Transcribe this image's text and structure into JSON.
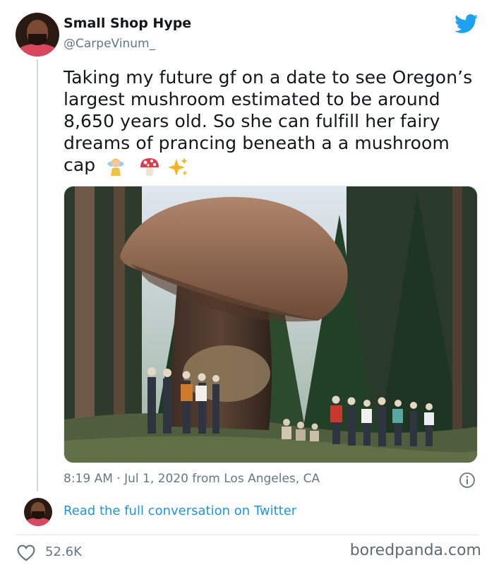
{
  "user": {
    "display_name": "Small Shop Hype",
    "handle": "@CarpeVinum_",
    "avatar": "user-avatar"
  },
  "tweet": {
    "text": "Taking my future gf on a date to see Oregon’s largest mushroom estimated to be around 8,650 years old. So she can fulfill her fairy dreams of prancing beneath a a mushroom cap",
    "emojis": [
      "fairy-emoji",
      "mushroom-emoji",
      "sparkles-emoji"
    ],
    "image": "giant-mushroom-photo",
    "timestamp": "8:19 AM · Jul 1, 2020 from Los Angeles, CA"
  },
  "footer": {
    "read_link": "Read the full conversation on Twitter",
    "like_count": "52.6K",
    "watermark": "boredpanda.com"
  },
  "colors": {
    "twitter_blue": "#1da1f2",
    "link_blue": "#1b95e0",
    "secondary_text": "#657786",
    "heart_outline": "#657786"
  },
  "icons": [
    "twitter-bird-icon",
    "info-icon",
    "heart-icon"
  ]
}
